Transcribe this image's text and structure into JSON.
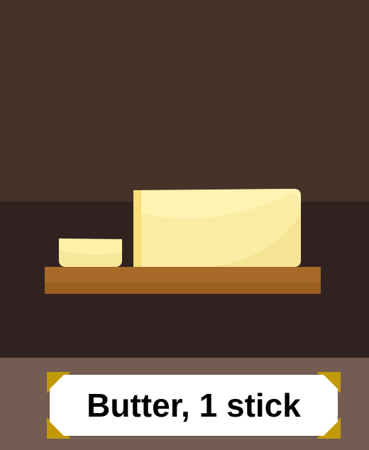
{
  "label": {
    "text": "Butter, 1 stick"
  },
  "colors": {
    "wall": "#47322a",
    "counter": "#302220",
    "caption_band": "#735c51",
    "board": "#a06424",
    "butter": "#fdf1a8",
    "label_bg": "#ffffff",
    "corner_accent": "#c29a08"
  },
  "icons": {
    "butter_stick": "butter-stick-icon",
    "butter_slice": "butter-slice-icon",
    "cutting_board": "cutting-board-icon"
  }
}
